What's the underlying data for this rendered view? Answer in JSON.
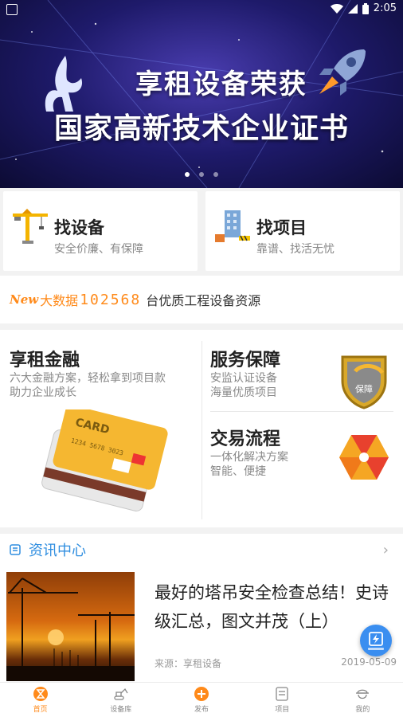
{
  "status_bar": {
    "time": "2:05"
  },
  "banner": {
    "line1": "享租设备荣获",
    "line2": "国家高新技术企业证书",
    "dots": 3,
    "active_dot": 0
  },
  "finders": [
    {
      "title": "找设备",
      "subtitle": "安全价廉、有保障",
      "icon": "tower-crane-icon"
    },
    {
      "title": "找项目",
      "subtitle": "靠谱、找活无忧",
      "icon": "building-site-icon"
    }
  ],
  "bigdata": {
    "badge": "New",
    "label": "大数据",
    "count": "102568",
    "tail": "台优质工程设备资源"
  },
  "services": {
    "finance": {
      "title": "享租金融",
      "line1": "六大金融方案，轻松拿到项目款",
      "line2": "助力企业成长"
    },
    "guarantee": {
      "title": "服务保障",
      "line1": "安监认证设备",
      "line2": "海量优质项目",
      "badge": "保障"
    },
    "process": {
      "title": "交易流程",
      "line1": "一体化解决方案",
      "line2": "智能、便捷"
    }
  },
  "news": {
    "header": "资讯中心",
    "item": {
      "title": "最好的塔吊安全检查总结！史诗级汇总，图文并茂（上）",
      "source": "来源：享租设备",
      "date": "2019-05-09"
    }
  },
  "tabs": [
    {
      "label": "首页",
      "icon": "home-hourglass-icon",
      "active": true
    },
    {
      "label": "设备库",
      "icon": "excavator-icon",
      "active": false
    },
    {
      "label": "发布",
      "icon": "plus-circle-icon",
      "active": false
    },
    {
      "label": "项目",
      "icon": "project-list-icon",
      "active": false
    },
    {
      "label": "我的",
      "icon": "worker-helmet-icon",
      "active": false
    }
  ],
  "colors": {
    "accent": "#ff8a1a",
    "link_blue": "#2f8ee0",
    "banner_bg": "#1e1a6a"
  }
}
